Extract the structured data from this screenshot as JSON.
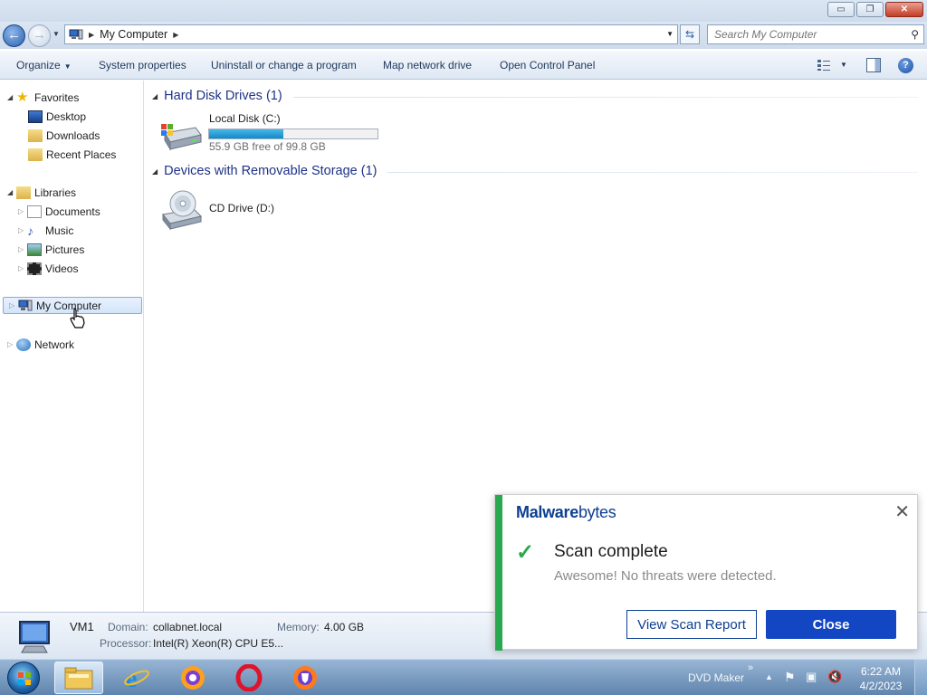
{
  "window": {
    "minimize": "▭",
    "maximize": "❐",
    "close": "✕"
  },
  "address": {
    "path": "My Computer",
    "search_placeholder": "Search My Computer"
  },
  "toolbar": {
    "organize": "Organize",
    "system_properties": "System properties",
    "uninstall": "Uninstall or change a program",
    "map_drive": "Map network drive",
    "control_panel": "Open Control Panel",
    "help": "?"
  },
  "nav": {
    "favorites": "Favorites",
    "desktop": "Desktop",
    "downloads": "Downloads",
    "recent": "Recent Places",
    "libraries": "Libraries",
    "documents": "Documents",
    "music": "Music",
    "pictures": "Pictures",
    "videos": "Videos",
    "my_computer": "My Computer",
    "network": "Network"
  },
  "content": {
    "hdd_group": "Hard Disk Drives (1)",
    "local_disk_name": "Local Disk (C:)",
    "local_disk_free": "55.9 GB free of 99.8 GB",
    "local_disk_used_fraction": 0.44,
    "removable_group": "Devices with Removable Storage (1)",
    "cd_drive_name": "CD Drive (D:)"
  },
  "details": {
    "name": "VM1",
    "domain_label": "Domain:",
    "domain_value": "collabnet.local",
    "memory_label": "Memory:",
    "memory_value": "4.00 GB",
    "processor_label": "Processor:",
    "processor_value": "Intel(R) Xeon(R) CPU E5..."
  },
  "toast": {
    "brand_bold": "Malware",
    "brand_light": "bytes",
    "title": "Scan complete",
    "message": "Awesome! No threats were detected.",
    "view_report": "View Scan Report",
    "close": "Close",
    "accent_color": "#2aa84f",
    "brand_color": "#0d3f92"
  },
  "taskbar": {
    "toolbar_label": "DVD Maker",
    "chevron": "»",
    "time": "6:22 AM",
    "date": "4/2/2023",
    "apps": [
      "windows-explorer",
      "internet-explorer",
      "firefox",
      "opera",
      "brave-browser"
    ]
  }
}
